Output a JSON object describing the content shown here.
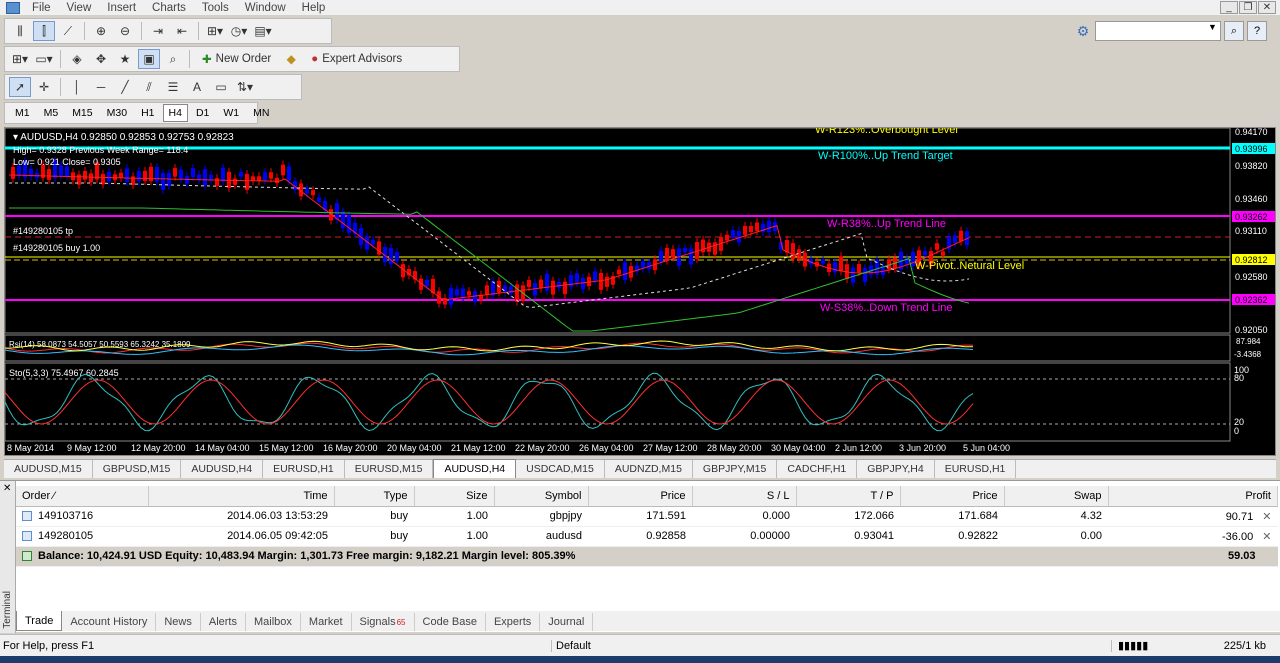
{
  "menu": [
    "File",
    "View",
    "Insert",
    "Charts",
    "Tools",
    "Window",
    "Help"
  ],
  "toolbar2": {
    "new_order": "New Order",
    "expert_advisors": "Expert Advisors"
  },
  "timeframes": [
    "M1",
    "M5",
    "M15",
    "M30",
    "H1",
    "H4",
    "D1",
    "W1",
    "MN"
  ],
  "active_timeframe": "H4",
  "chart": {
    "header": "AUDUSD,H4  0.92850 0.92853 0.92753 0.92823",
    "prev_week": "High= 0.9328     Previous Week Range= 118.4",
    "low_close": "Low= 0.921     Close= 0.9305",
    "order_tp": "#149280105 tp",
    "order_buy": "#149280105 buy 1.00",
    "lines": {
      "r123": "W-R123%..Overbought Level",
      "r100": "W-R100%..Up Trend Target",
      "r38": "W-R38%..Up Trend Line",
      "pivot": "W-Pivot..Netural Level",
      "s38": "W-S38%..Down Trend Line"
    },
    "price_labels": [
      "0.94170",
      "0.93996",
      "0.93820",
      "0.93460",
      "0.93262",
      "0.93110",
      "0.92812",
      "0.92580",
      "0.92362",
      "0.92050"
    ],
    "rsi_label": "Rsi(14) 58.0873 54.5057 50.5593 65.3242 35.1809",
    "rsi_scale": [
      "87.984",
      "-3.4368"
    ],
    "sto_label": "Sto(5,3,3) 75.4967 60.2845",
    "sto_scale": [
      "100",
      "80",
      "20",
      "0"
    ],
    "time_labels": [
      "8 May 2014",
      "9 May 12:00",
      "12 May 20:00",
      "14 May 04:00",
      "15 May 12:00",
      "16 May 20:00",
      "20 May 04:00",
      "21 May 12:00",
      "22 May 20:00",
      "26 May 04:00",
      "27 May 12:00",
      "28 May 20:00",
      "30 May 04:00",
      "2 Jun 12:00",
      "3 Jun 20:00",
      "5 Jun 04:00"
    ],
    "colors": {
      "up": "#0000ff",
      "down": "#ff0000",
      "cyan": "#00ffff",
      "magenta": "#ff00ff",
      "yellow": "#ffff00",
      "pivot_text": "#ffff00",
      "r38_text": "#ff00ff",
      "r100_text": "#00ffff"
    }
  },
  "chart_tabs": [
    "AUDUSD,M15",
    "GBPUSD,M15",
    "AUDUSD,H4",
    "EURUSD,H1",
    "EURUSD,M15",
    "AUDUSD,H4",
    "USDCAD,M15",
    "AUDNZD,M15",
    "GBPJPY,M15",
    "CADCHF,H1",
    "GBPJPY,H4",
    "EURUSD,H1"
  ],
  "active_chart_tab": 5,
  "terminal": {
    "side_label": "Terminal",
    "columns": [
      "Order",
      "Time",
      "Type",
      "Size",
      "Symbol",
      "Price",
      "S / L",
      "T / P",
      "Price",
      "Swap",
      "Profit"
    ],
    "rows": [
      {
        "order": "149103716",
        "time": "2014.06.03 13:53:29",
        "type": "buy",
        "size": "1.00",
        "symbol": "gbpjpy",
        "price": "171.591",
        "sl": "0.000",
        "tp": "172.066",
        "cur": "171.684",
        "swap": "4.32",
        "profit": "90.71"
      },
      {
        "order": "149280105",
        "time": "2014.06.05 09:42:05",
        "type": "buy",
        "size": "1.00",
        "symbol": "audusd",
        "price": "0.92858",
        "sl": "0.00000",
        "tp": "0.93041",
        "cur": "0.92822",
        "swap": "0.00",
        "profit": "-36.00"
      }
    ],
    "balance_line": "Balance: 10,424.91 USD  Equity: 10,483.94  Margin: 1,301.73  Free margin: 9,182.21  Margin level: 805.39%",
    "balance_profit": "59.03",
    "tabs": [
      "Trade",
      "Account History",
      "News",
      "Alerts",
      "Mailbox",
      "Market",
      "Signals",
      "Code Base",
      "Experts",
      "Journal"
    ],
    "signals_badge": "65",
    "active_tab": "Trade"
  },
  "status": {
    "help": "For Help, press F1",
    "profile": "Default",
    "traffic": "225/1 kb"
  }
}
